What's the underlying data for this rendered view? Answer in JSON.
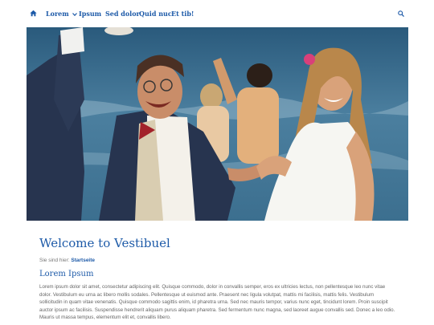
{
  "nav": {
    "items": [
      {
        "label": "Lorem",
        "has_dropdown": true
      },
      {
        "label": "Ipsum"
      },
      {
        "label": "Sed dolor"
      },
      {
        "label": "Quid nuc"
      },
      {
        "label": "Et tib!"
      }
    ],
    "home_icon": "home-icon",
    "search_icon": "search-icon"
  },
  "hero": {
    "image": "couple-dancing-on-beach"
  },
  "main": {
    "title": "Welcome to Vestibuel",
    "breadcrumb_prefix": "Sie sind hier:",
    "breadcrumb_current": "Startseite",
    "section_title": "Lorem Ipsum",
    "body": "Lorem ipsum dolor sit amet, consectetur adipiscing elit. Quisque commodo, dolor in convallis semper, eros ex ultricies lectus, non pellentesque leo nunc vitae dolor. Vestibulum eu urna ac libero mollis sodales. Pellentesque ut euismod ante. Praesent nec ligula volutpat, mattis mi facilisis, mattis felis. Vestibulum sollicitudin in quam vitae venenatis. Quisque commodo sagittis enim, id pharetra urna. Sed nec mauris tempor, varius nunc eget, tincidunt lorem. Proin suscipit auctor ipsum ac facilisis. Suspendisse hendrerit aliquam purus aliquam pharetra. Sed fermentum nunc magna, sed laoreet augue convallis sed. Donec a leo odio. Mauris ut massa tempus, elementum elit et, convallis libero."
  },
  "colors": {
    "accent": "#1d5aa8",
    "text": "#666666",
    "background": "#ffffff"
  }
}
